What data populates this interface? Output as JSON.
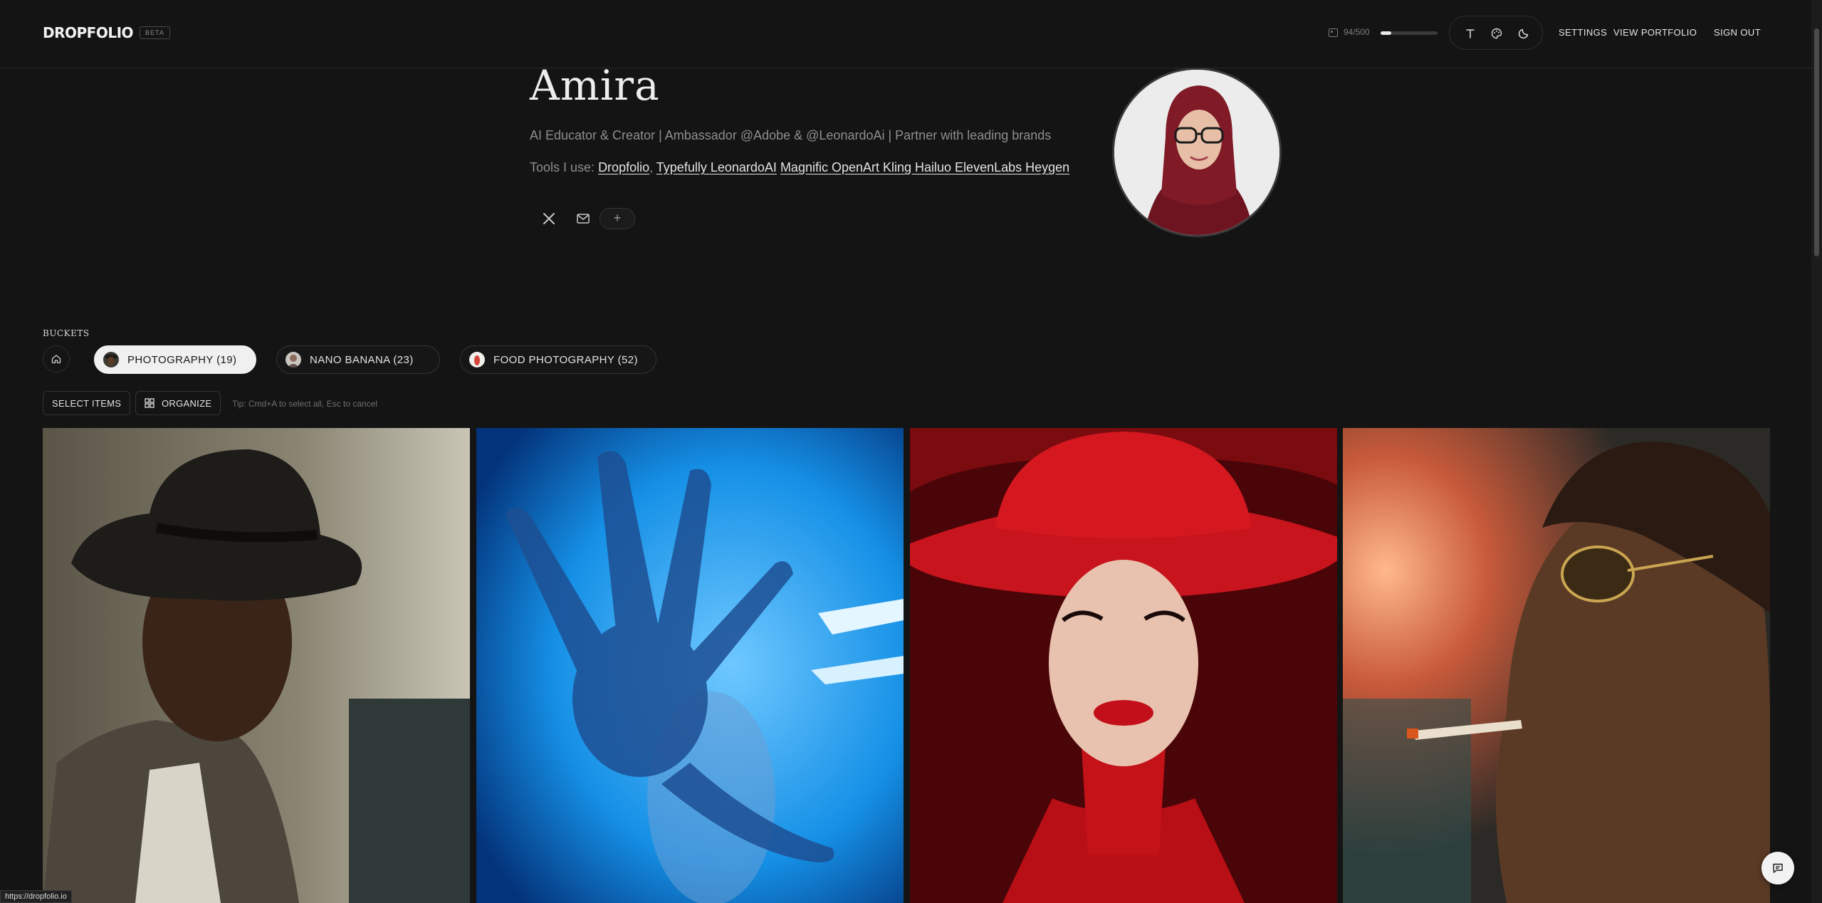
{
  "header": {
    "logo": "DROPFOLIO",
    "beta": "BETA",
    "usage_text": "94/500",
    "usage_fraction": 0.188,
    "nav": [
      "SETTINGS",
      "VIEW PORTFOLIO",
      "SIGN OUT"
    ],
    "tool_icons": [
      "text-icon",
      "palette-icon",
      "moon-icon"
    ]
  },
  "profile": {
    "name": "Amira",
    "bio": "AI Educator & Creator | Ambassador @Adobe & @LeonardoAi | Partner with leading brands",
    "tools_prefix": "Tools I use:",
    "tools": [
      "Dropfolio",
      "Typefully LeonardoAI",
      "Magnific OpenArt Kling Hailuo ElevenLabs Heygen"
    ],
    "tools_separators": [
      ", ",
      " "
    ],
    "social_icons": [
      "x-icon",
      "mail-icon"
    ],
    "add_label": "+"
  },
  "buckets": {
    "label": "BUCKETS",
    "items": [
      {
        "label": "PHOTOGRAPHY (19)",
        "active": true
      },
      {
        "label": "NANO BANANA (23)",
        "active": false
      },
      {
        "label": "FOOD PHOTOGRAPHY (52)",
        "active": false
      }
    ]
  },
  "toolbar": {
    "select_label": "SELECT ITEMS",
    "organize_label": "ORGANIZE",
    "tip": "Tip: Cmd+A to select all, Esc to cancel"
  },
  "gallery": {
    "items": [
      "man-in-fedora-photo",
      "blue-hand-photo",
      "red-hat-woman-photo",
      "man-with-sunglasses-photo"
    ]
  },
  "status_url": "https://dropfolio.io",
  "colors": {
    "background": "#141414",
    "accent_red": "#c8141c",
    "active_pill": "#f0f0f0"
  }
}
